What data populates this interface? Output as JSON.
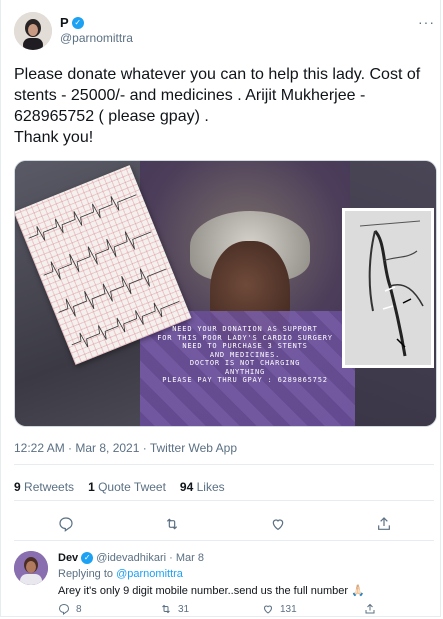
{
  "tweet": {
    "author_name": "P",
    "handle": "@parnomittra",
    "more_label": "···",
    "text": "Please donate whatever you can to help this lady. Cost of stents - 25000/- and medicines . Arijit Mukherjee - 628965752 ( please gpay) .\nThank you!",
    "media_overlay_lines": [
      "NEED YOUR DONATION AS SUPPORT",
      "FOR THIS POOR LADY'S CARDIO SURGERY",
      "NEED TO PURCHASE 3 STENTS",
      "AND MEDICINES.",
      "DOCTOR IS NOT CHARGING",
      "ANYTHING",
      "PLEASE PAY THRU GPAY : 6289865752"
    ],
    "timestamp": "12:22 AM · Mar 8, 2021 · Twitter Web App",
    "retweets_count": "9",
    "retweets_label": "Retweets",
    "quote_count": "1",
    "quote_label": "Quote Tweet",
    "likes_count": "94",
    "likes_label": "Likes"
  },
  "reply": {
    "author_name": "Dev",
    "handle_and_date": "@idevadhikari · Mar 8",
    "replying_prefix": "Replying to",
    "replying_to": "@parnomittra",
    "text": "Arey it's only 9 digit mobile number..send us the full number 🙏🏻",
    "reply_count": "8",
    "retweet_count": "31",
    "like_count": "131"
  },
  "colors": {
    "accent": "#1da1f2",
    "muted": "#5b7083",
    "text": "#0f1419"
  },
  "icons": [
    "verified-badge-icon",
    "reply-icon",
    "retweet-icon",
    "like-icon",
    "share-icon"
  ]
}
